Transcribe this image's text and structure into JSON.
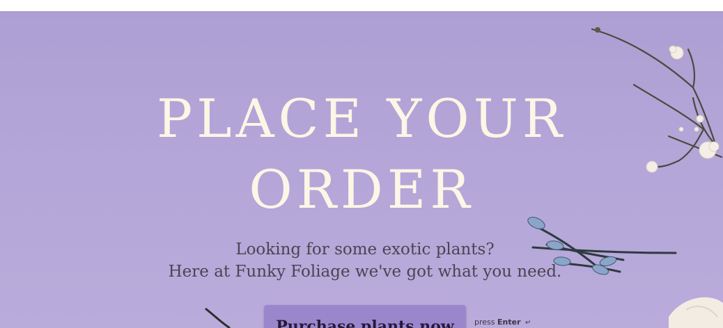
{
  "hero": {
    "title_line_1": "PLACE YOUR",
    "title_line_2": "ORDER",
    "subtitle_line_1": "Looking for some exotic plants?",
    "subtitle_line_2": "Here at Funky Foliage we've got what you need."
  },
  "cta": {
    "button_label": "Purchase plants now",
    "press_prefix": "press",
    "press_key": "Enter",
    "return_icon": "↵"
  },
  "colors": {
    "background": "#b3a5d7",
    "title": "#fbf6e6",
    "subtitle": "#4b4453",
    "button": "#9a86cb"
  },
  "decorations": {
    "background_image": "lavender-flowers"
  }
}
